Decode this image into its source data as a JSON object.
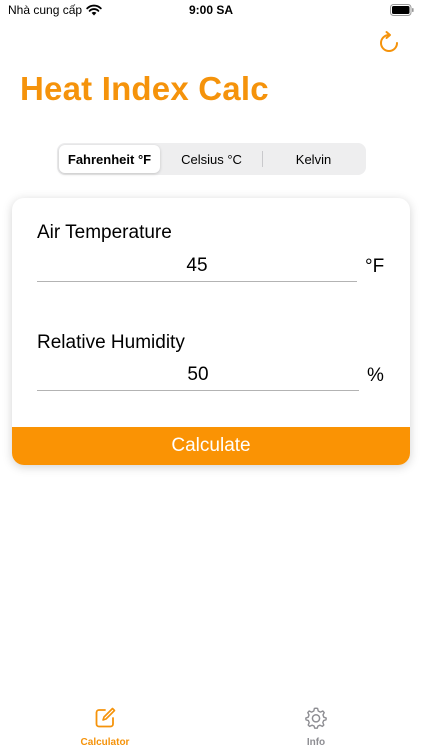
{
  "status_bar": {
    "carrier": "Nhà cung cấp",
    "time": "9:00 SA"
  },
  "header": {
    "title": "Heat Index Calc",
    "refresh_icon": "refresh-icon"
  },
  "units": {
    "options": [
      "Fahrenheit °F",
      "Celsius °C",
      "Kelvin"
    ],
    "selected": "Fahrenheit °F"
  },
  "form": {
    "air_temperature": {
      "label": "Air Temperature",
      "value": "45",
      "unit": "°F"
    },
    "relative_humidity": {
      "label": "Relative Humidity",
      "value": "50",
      "unit": "%"
    },
    "calculate_label": "Calculate"
  },
  "tab_bar": {
    "tabs": [
      {
        "label": "Calculator",
        "icon": "pencil-square-icon",
        "active": true
      },
      {
        "label": "Info",
        "icon": "gear-icon",
        "active": false
      }
    ]
  },
  "colors": {
    "accent": "#F5930B",
    "button": "#FA9304",
    "inactive": "#8E8E93"
  }
}
